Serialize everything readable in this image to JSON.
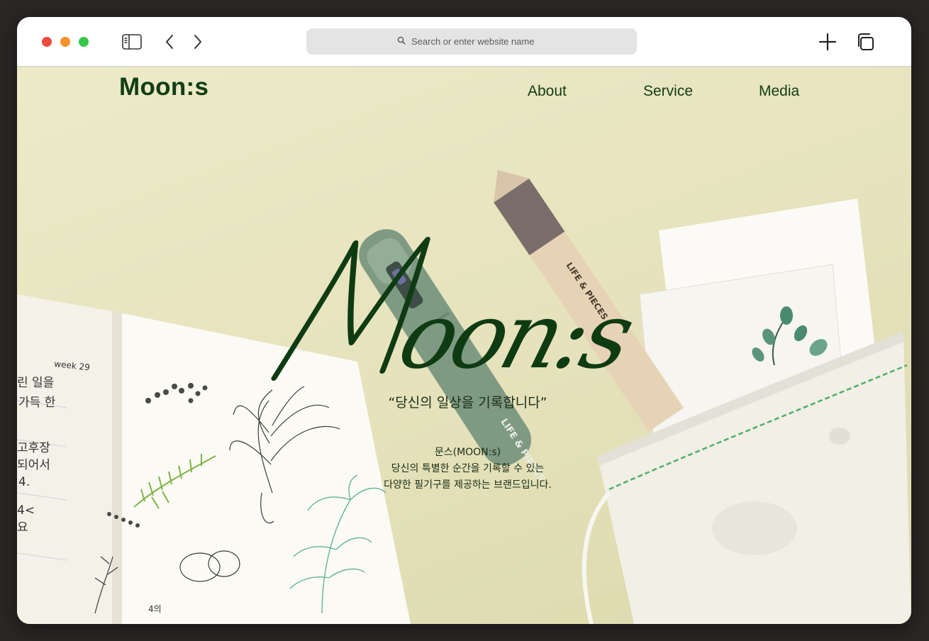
{
  "browser": {
    "address_placeholder": "Search or enter website name",
    "icons": [
      "sidebar-icon",
      "back-chevron-icon",
      "forward-chevron-icon",
      "search-icon",
      "plus-icon",
      "tabs-icon"
    ]
  },
  "site": {
    "logo": "Moon:s",
    "nav": [
      {
        "label": "About"
      },
      {
        "label": "Service"
      },
      {
        "label": "Media"
      }
    ],
    "hero": {
      "script_title": "Moon:s",
      "tagline": "“당신의 일상을 기록합니다”",
      "description_lines": [
        "문스(MOON:s)",
        "당신의 특별한 순간을 기록할 수 있는",
        "다양한 필기구를 제공하는 브랜드입니다."
      ]
    },
    "photo": {
      "notebook_week": "week 29",
      "notebook_note": "4의",
      "pencil_brand": "LIFE & PIECES",
      "pen_brand": "LIFE & PIECES"
    }
  },
  "colors": {
    "brand_green": "#113d14",
    "background": "#e9e6c4"
  }
}
